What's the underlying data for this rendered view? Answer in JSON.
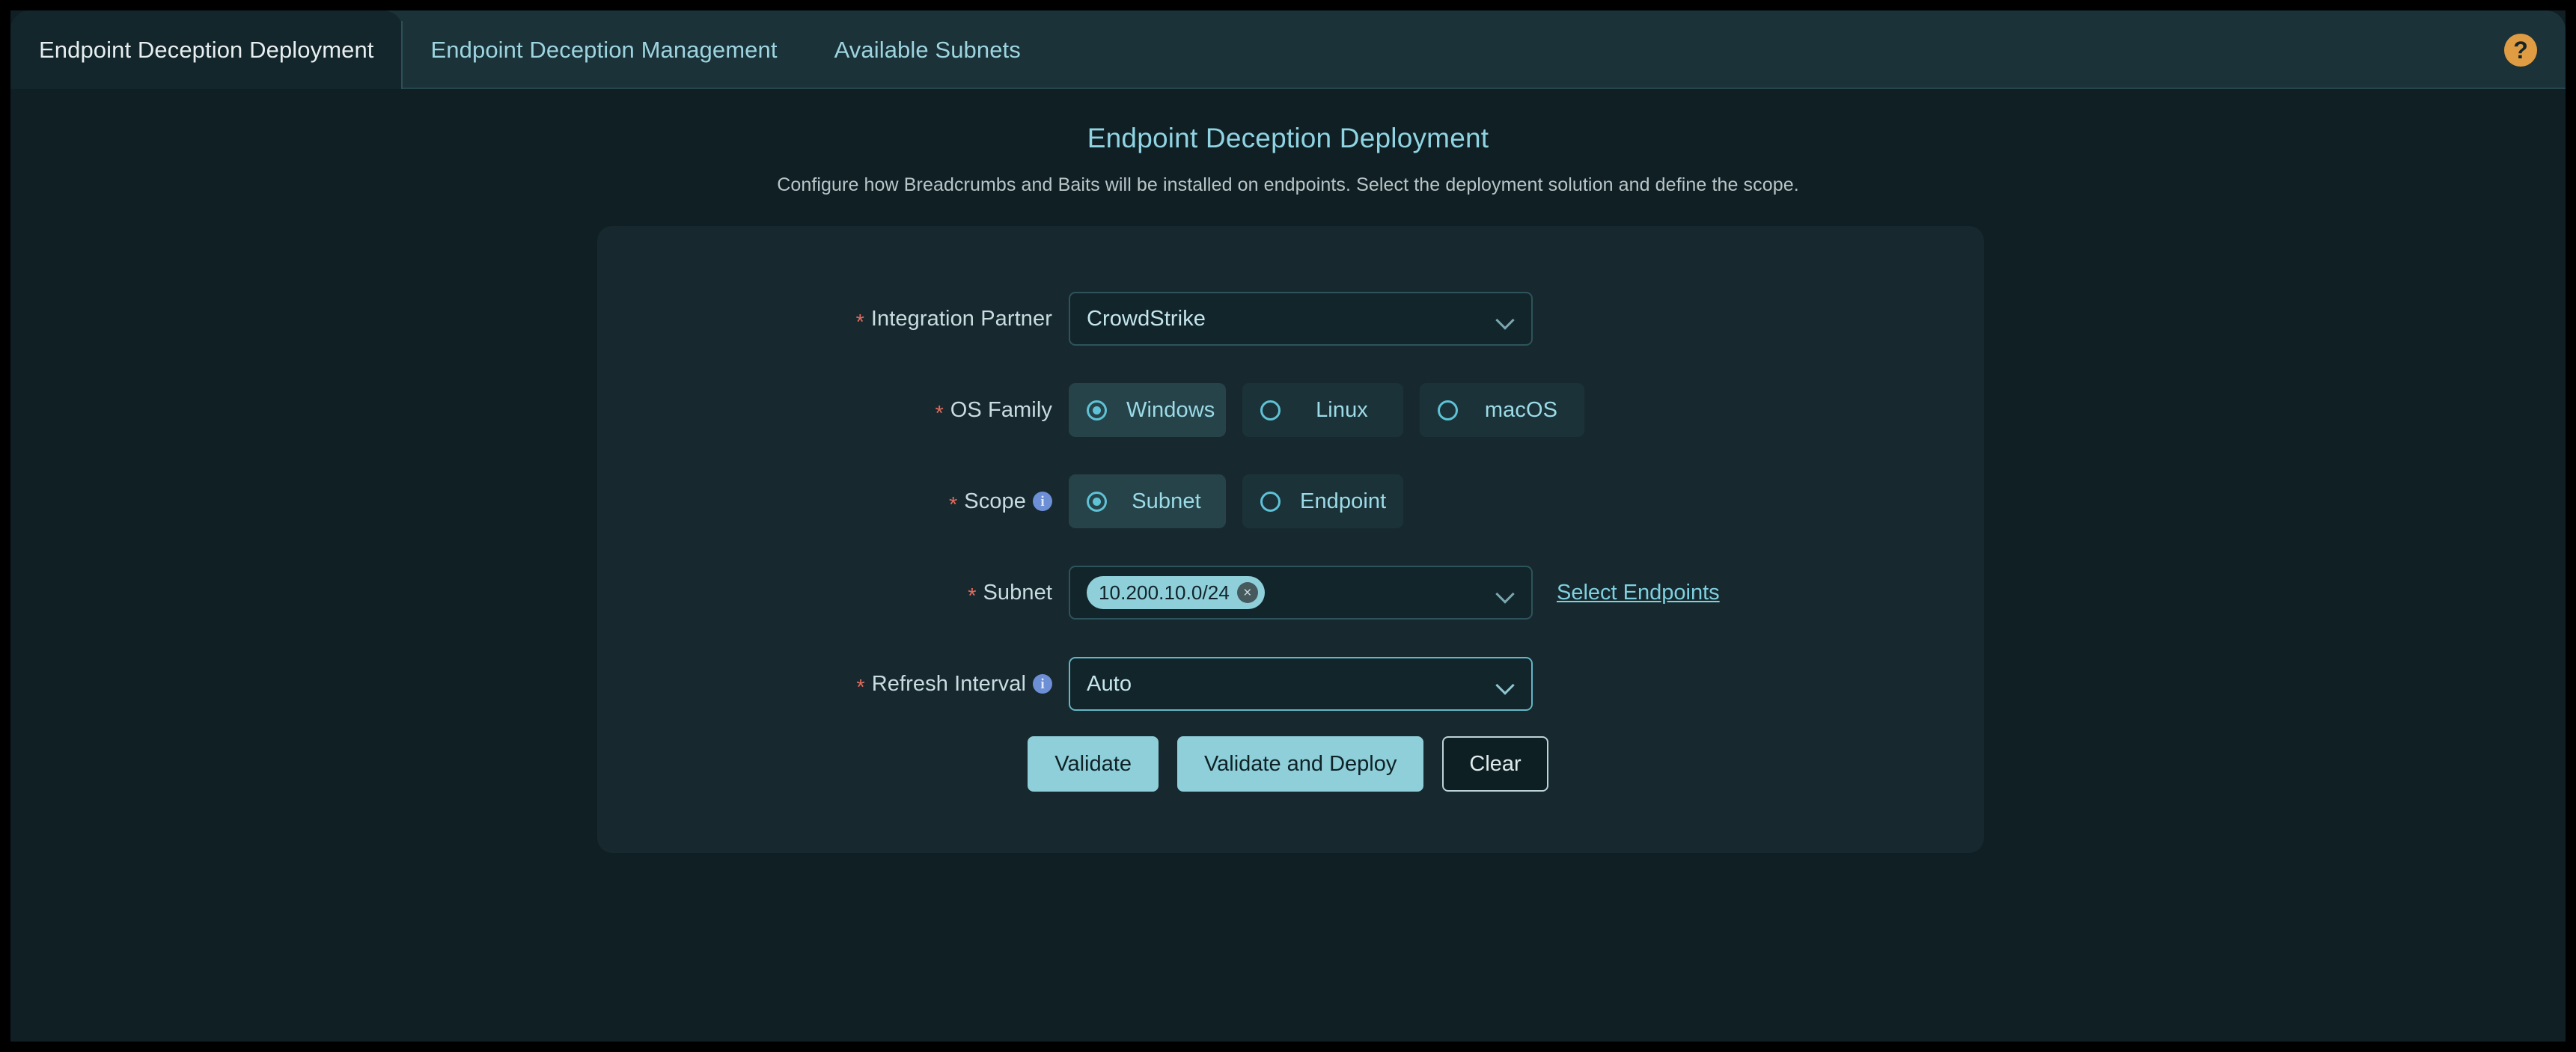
{
  "tabs": [
    {
      "label": "Endpoint Deception Deployment",
      "active": true
    },
    {
      "label": "Endpoint Deception Management",
      "active": false
    },
    {
      "label": "Available Subnets",
      "active": false
    }
  ],
  "help": {
    "icon": "help-icon",
    "glyph": "?",
    "color": "#e09c42"
  },
  "page": {
    "title": "Endpoint Deception Deployment",
    "subtitle": "Configure how Breadcrumbs and Baits will be installed on endpoints. Select the deployment solution and define the scope."
  },
  "form": {
    "required_marker": "*",
    "integration_partner": {
      "label": "Integration Partner",
      "value": "CrowdStrike"
    },
    "os_family": {
      "label": "OS Family",
      "options": [
        {
          "label": "Windows",
          "selected": true
        },
        {
          "label": "Linux",
          "selected": false
        },
        {
          "label": "macOS",
          "selected": false
        }
      ]
    },
    "scope": {
      "label": "Scope",
      "info": "info-icon",
      "options": [
        {
          "label": "Subnet",
          "selected": true
        },
        {
          "label": "Endpoint",
          "selected": false
        }
      ]
    },
    "subnet": {
      "label": "Subnet",
      "tag": "10.200.10.0/24",
      "remove_glyph": "×",
      "link": "Select Endpoints"
    },
    "refresh_interval": {
      "label": "Refresh Interval",
      "info": "info-icon",
      "value": "Auto"
    }
  },
  "buttons": {
    "validate": "Validate",
    "validate_deploy": "Validate and Deploy",
    "clear": "Clear"
  },
  "colors": {
    "accent": "#8ecfda",
    "app_bg": "#101f23",
    "card_bg": "#17292e",
    "tabbar_bg": "#1a3238",
    "required": "#e06b5e",
    "help": "#e09c42",
    "info": "#6d8fd6"
  }
}
